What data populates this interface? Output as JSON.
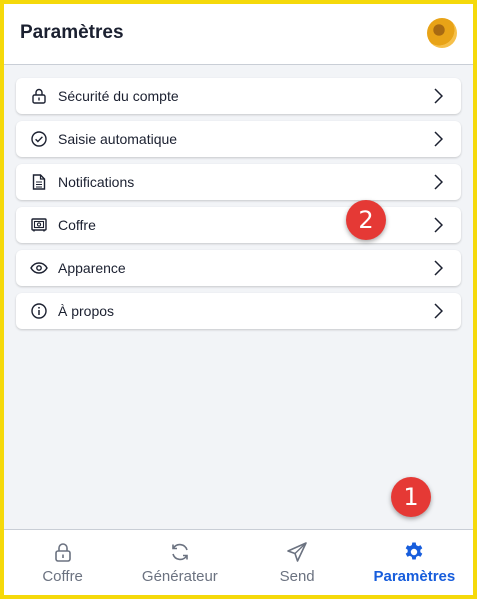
{
  "header": {
    "title": "Paramètres"
  },
  "menu": [
    {
      "label": "Sécurité du compte",
      "icon": "lock-icon"
    },
    {
      "label": "Saisie automatique",
      "icon": "check-circle-icon"
    },
    {
      "label": "Notifications",
      "icon": "document-icon"
    },
    {
      "label": "Coffre",
      "icon": "vault-icon"
    },
    {
      "label": "Apparence",
      "icon": "eye-icon"
    },
    {
      "label": "À propos",
      "icon": "info-icon"
    }
  ],
  "annotations": {
    "badge_1": "1",
    "badge_2": "2"
  },
  "nav": {
    "tabs": [
      {
        "label": "Coffre",
        "icon": "lock-icon",
        "active": false
      },
      {
        "label": "Générateur",
        "icon": "refresh-icon",
        "active": false
      },
      {
        "label": "Send",
        "icon": "paper-plane-icon",
        "active": false
      },
      {
        "label": "Paramètres",
        "icon": "gear-icon",
        "active": true
      }
    ]
  },
  "colors": {
    "accent": "#175ddc",
    "badge": "#e53935",
    "frame": "#f5d90a"
  }
}
